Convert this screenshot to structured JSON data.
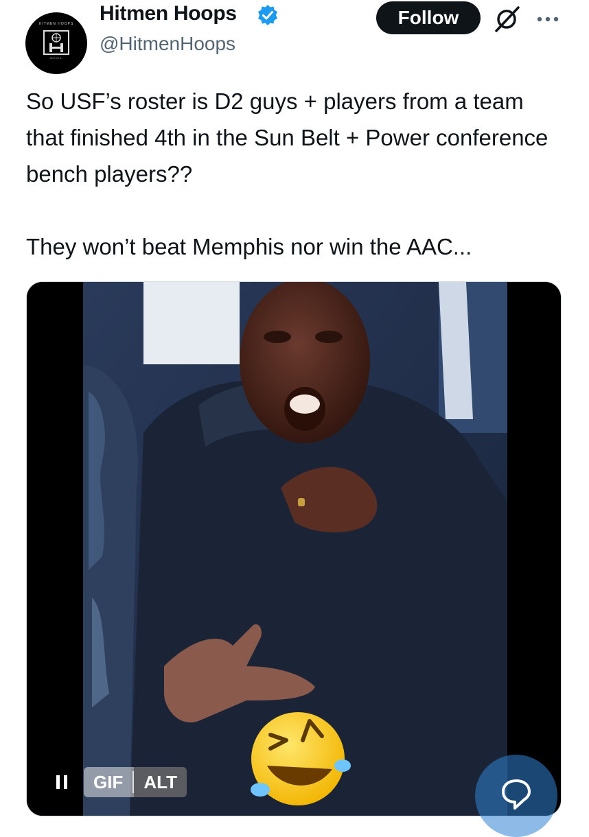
{
  "author": {
    "display_name": "Hitmen Hoops",
    "handle": "@HitmenHoops",
    "verified": true,
    "avatar_icon": "hitmen-hoops-logo",
    "avatar_text_top": "HITMEN HOOPS",
    "avatar_text_bottom": "MEDIA"
  },
  "actions": {
    "follow_label": "Follow",
    "grok_icon": "grok-icon",
    "more_icon": "more-icon"
  },
  "tweet": {
    "paragraph_1": "So USF’s roster is D2 guys + players from a team that finished 4th in the Sun Belt + Power conference bench players??",
    "paragraph_2": "They won’t beat Memphis nor win the AAC..."
  },
  "media": {
    "type": "gif",
    "gif_label": "GIF",
    "alt_label": "ALT",
    "pause_icon": "pause-icon",
    "overlay_emoji": "😆"
  },
  "reply_fab_icon": "reply-bubble-icon",
  "colors": {
    "text": "#0f1419",
    "secondary_text": "#536471",
    "verified_blue": "#1d9bf0",
    "follow_bg": "#0f1419"
  }
}
